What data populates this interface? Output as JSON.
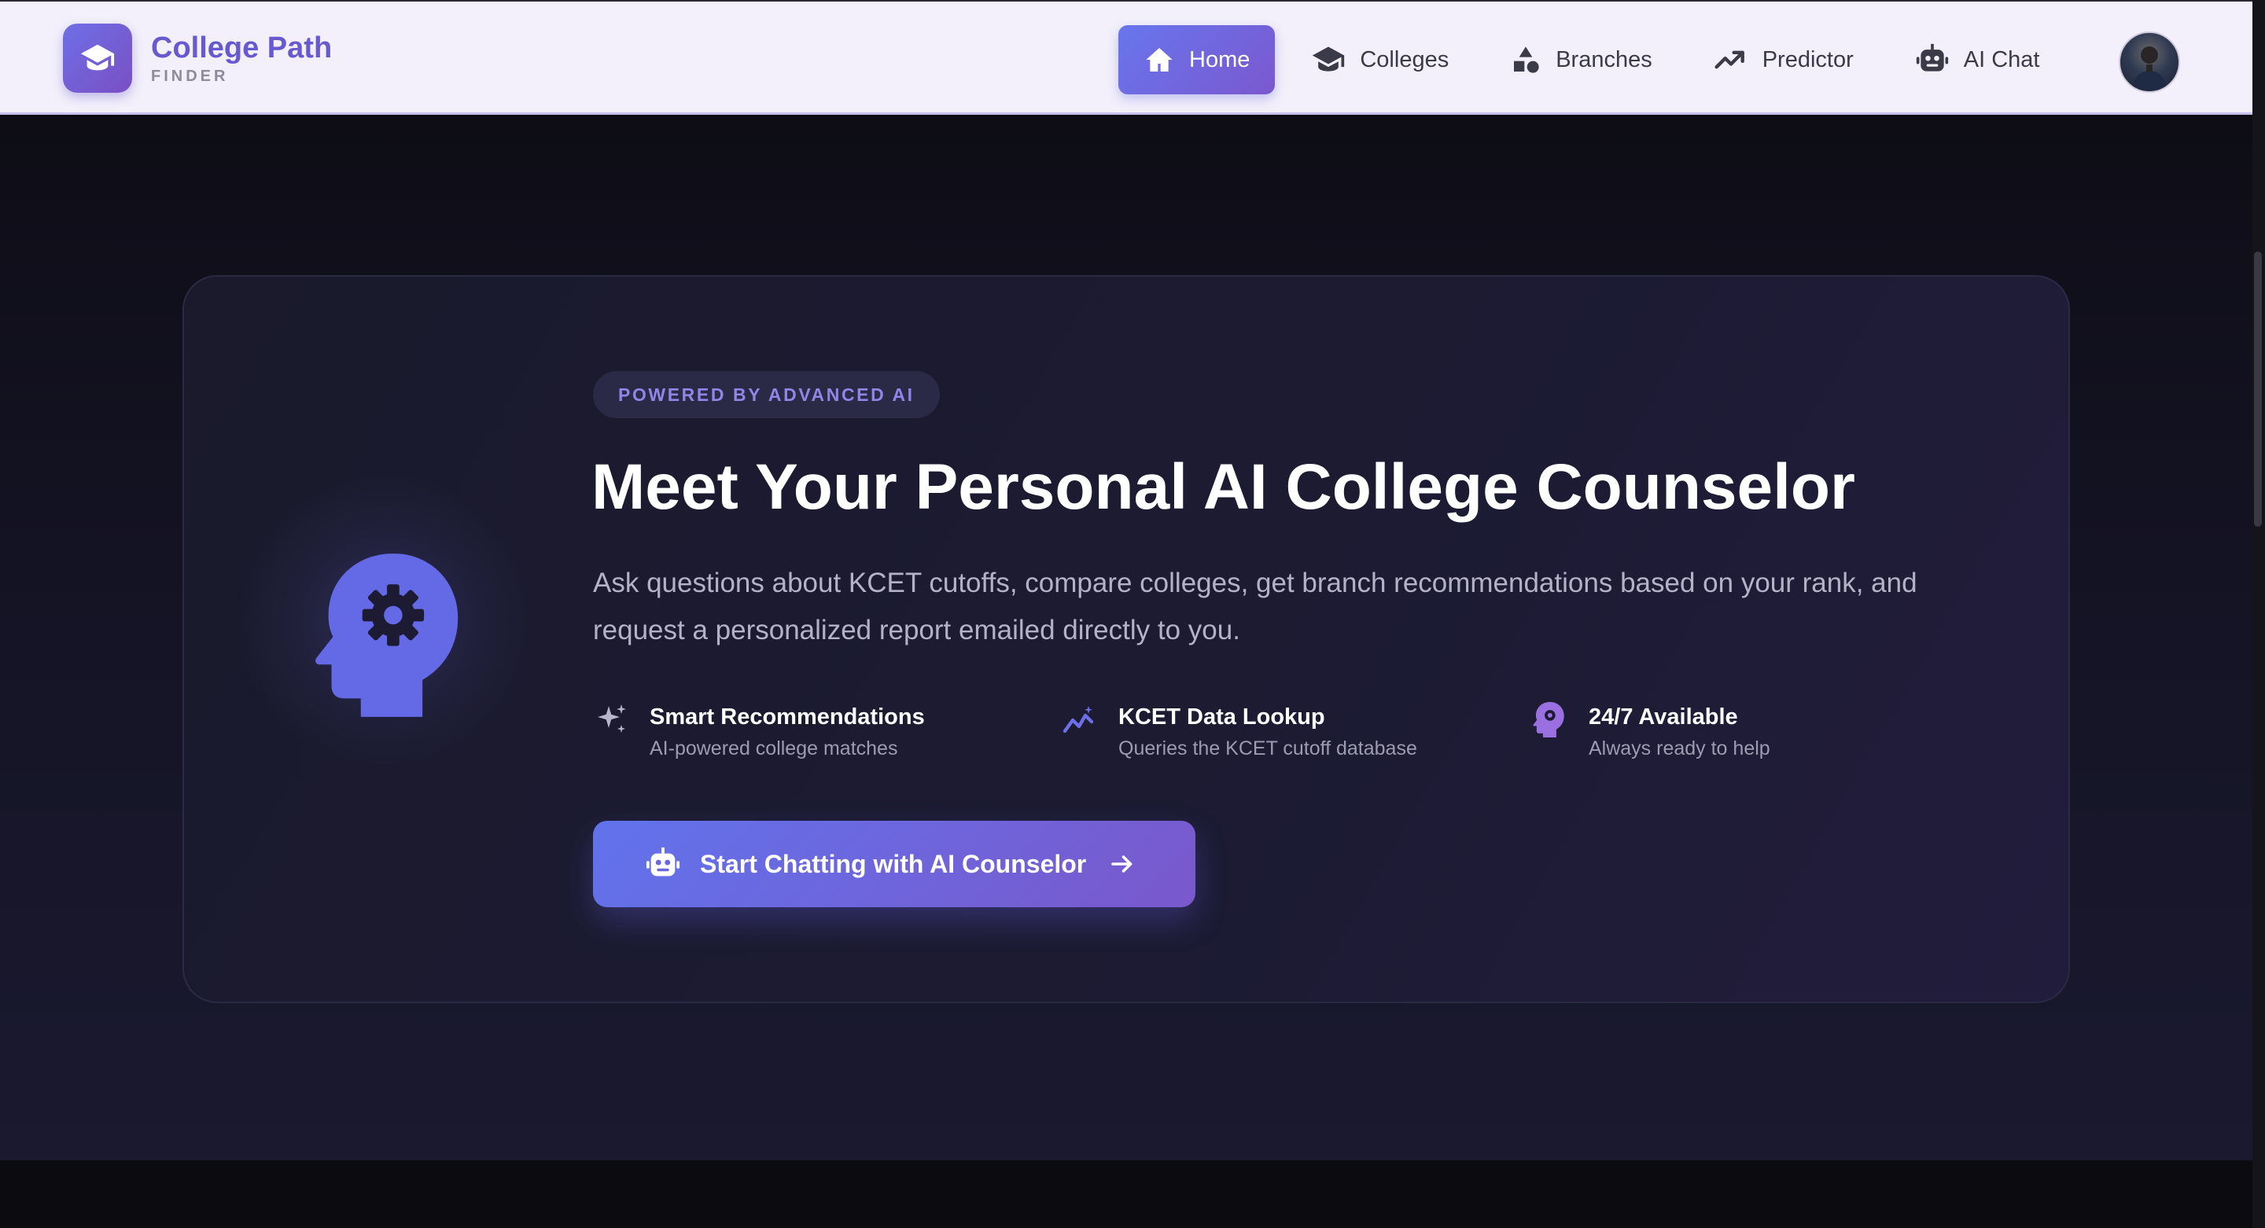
{
  "brand": {
    "name": "College Path",
    "subtitle": "FINDER",
    "icon": "graduation-cap-icon"
  },
  "nav": {
    "items": [
      {
        "label": "Home",
        "icon": "home-icon",
        "active": true
      },
      {
        "label": "Colleges",
        "icon": "graduation-cap-icon",
        "active": false
      },
      {
        "label": "Branches",
        "icon": "shapes-icon",
        "active": false
      },
      {
        "label": "Predictor",
        "icon": "trending-up-icon",
        "active": false
      },
      {
        "label": "AI Chat",
        "icon": "robot-icon",
        "active": false
      }
    ],
    "avatar": "user-avatar"
  },
  "hero": {
    "badge": "POWERED BY ADVANCED AI",
    "title": "Meet Your Personal AI College Counselor",
    "description": "Ask questions about KCET cutoffs, compare colleges, get branch recommendations based on your rank, and request a personalized report emailed directly to you.",
    "icon": "head-gear-icon",
    "features": [
      {
        "icon": "sparkles-icon",
        "title": "Smart Recommendations",
        "desc": "AI-powered college matches"
      },
      {
        "icon": "chart-line-icon",
        "title": "KCET Data Lookup",
        "desc": "Queries the KCET cutoff database"
      },
      {
        "icon": "head-gear-icon",
        "title": "24/7 Available",
        "desc": "Always ready to help"
      }
    ],
    "cta": {
      "label": "Start Chatting with AI Counselor",
      "icon": "robot-icon",
      "trailing_icon": "arrow-right-icon"
    }
  },
  "colors": {
    "accent": "#6a6fe8",
    "accent_purple": "#7a58cc",
    "navbar_bg": "#f3f0fb",
    "page_bg": "#0e0d16",
    "card_bg": "#1c1b33",
    "brand_text": "#6759cf"
  }
}
